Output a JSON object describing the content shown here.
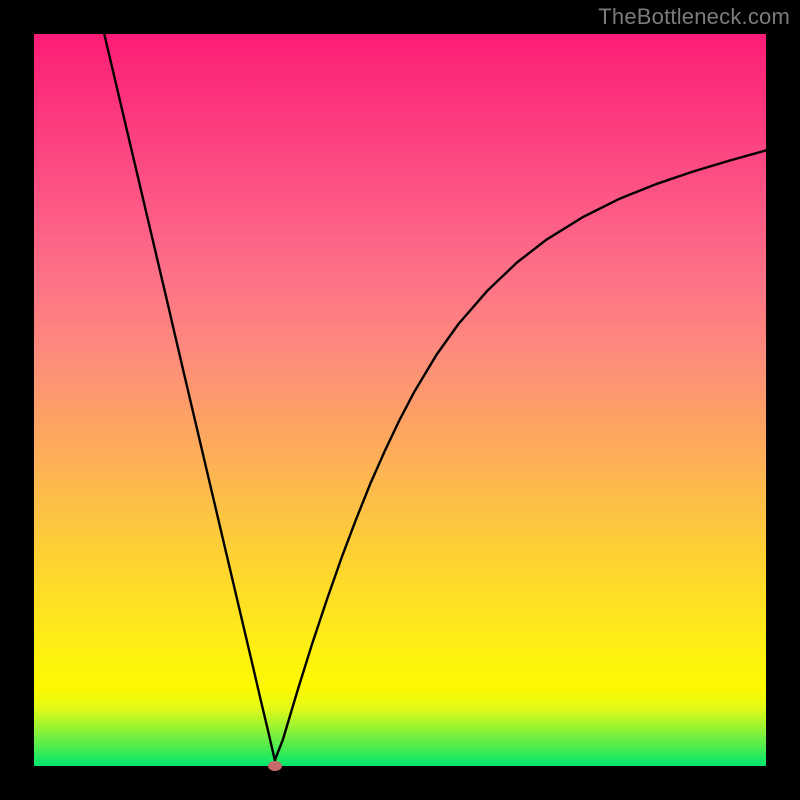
{
  "attribution": "TheBottleneck.com",
  "colors": {
    "frame": "#000000",
    "gradient_top": "#fc1b76",
    "gradient_bottom": "#00e66d",
    "curve": "#000000",
    "marker": "#c86a6a"
  },
  "chart_data": {
    "type": "line",
    "title": "",
    "xlabel": "",
    "ylabel": "",
    "xlim": [
      0,
      100
    ],
    "ylim": [
      0,
      100
    ],
    "grid": false,
    "legend": false,
    "marker": {
      "x": 32.9,
      "y": 0
    },
    "series": [
      {
        "name": "curve",
        "x": [
          9.6,
          12,
          14,
          16,
          18,
          20,
          22,
          24,
          26,
          28,
          30,
          31,
          32,
          32.9,
          34,
          36,
          38,
          40,
          42,
          44,
          46,
          48,
          50,
          52,
          55,
          58,
          62,
          66,
          70,
          75,
          80,
          85,
          90,
          95,
          100
        ],
        "values": [
          100,
          89.8,
          81.3,
          72.8,
          64.3,
          55.7,
          47.2,
          38.7,
          30.2,
          21.7,
          13.2,
          8.9,
          4.7,
          0.8,
          3.6,
          10.3,
          16.7,
          22.7,
          28.4,
          33.7,
          38.7,
          43.2,
          47.4,
          51.2,
          56.2,
          60.4,
          65,
          68.8,
          71.9,
          75,
          77.5,
          79.5,
          81.2,
          82.7,
          84.1
        ]
      }
    ]
  }
}
